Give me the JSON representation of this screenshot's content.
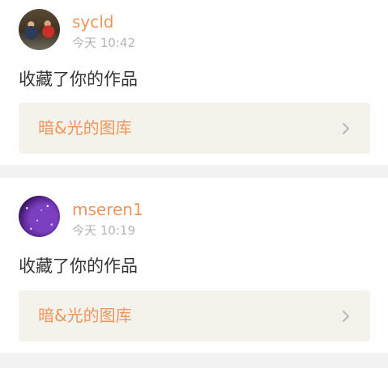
{
  "notifications": [
    {
      "username": "sycld",
      "time": "今天 10:42",
      "action": "收藏了你的作品",
      "album_title": "暗&光的图库"
    },
    {
      "username": "mseren1",
      "time": "今天 10:19",
      "action": "收藏了你的作品",
      "album_title": "暗&光的图库"
    }
  ],
  "colors": {
    "accent": "#f0955a",
    "timestamp": "#b4b4b4",
    "text": "#333333",
    "album_bg": "#f3f3ec",
    "divider": "#f2f2f2"
  },
  "icons": {
    "album_chevron": "chevron-right-icon"
  }
}
